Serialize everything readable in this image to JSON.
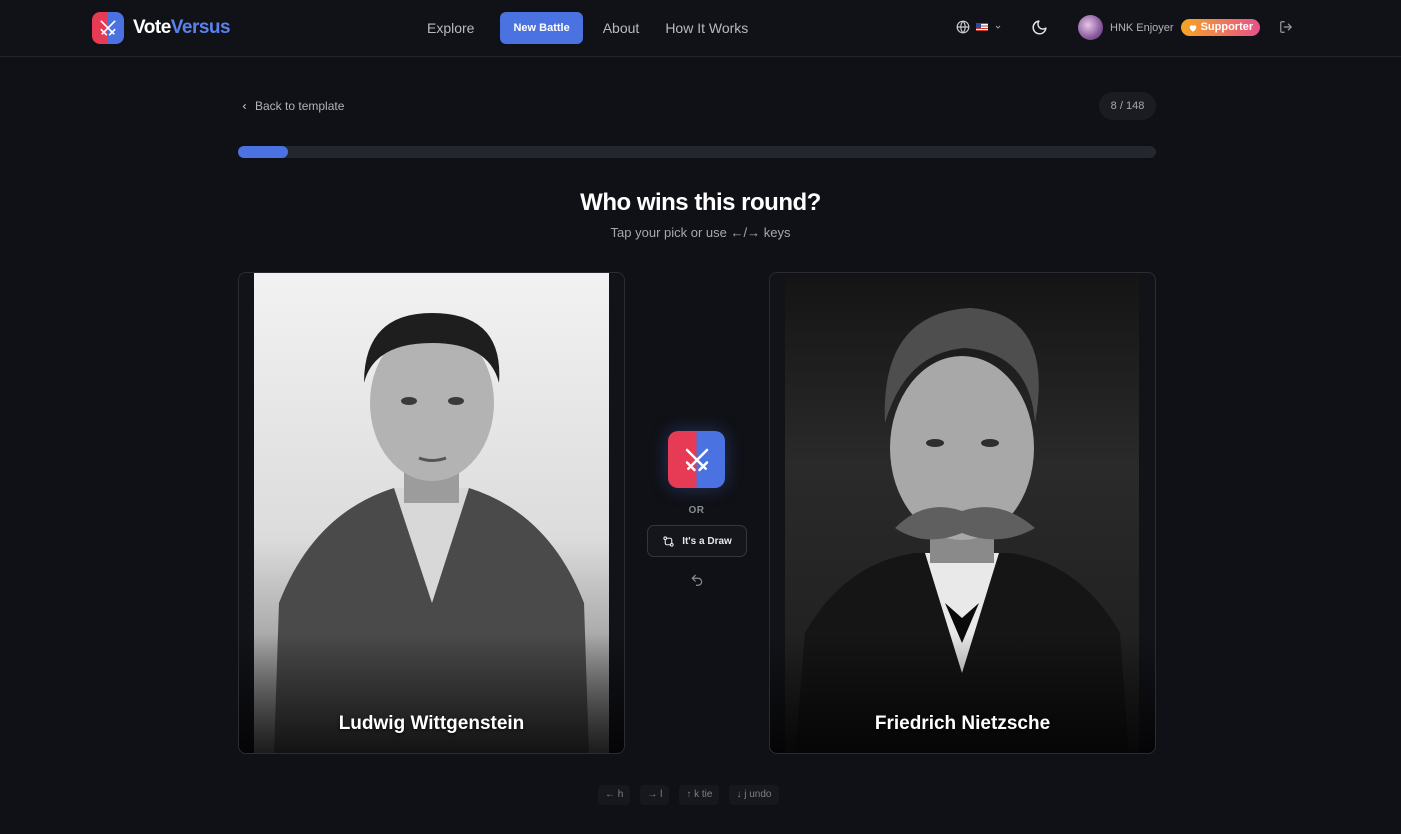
{
  "header": {
    "logo_word1": "Vote",
    "logo_word2": "Versus",
    "nav": {
      "explore": "Explore",
      "new_battle": "New Battle",
      "about": "About",
      "how_it_works": "How It Works"
    },
    "language_icon": "globe-icon",
    "theme_icon": "moon-icon",
    "user": {
      "name": "HNK Enjoyer",
      "badge": "Supporter"
    }
  },
  "back_link": "Back to template",
  "counter": "8 / 148",
  "progress": 0.054,
  "title": "Who wins this round?",
  "subtitle": "Tap your pick or use ←/→ keys",
  "contenders": {
    "left": {
      "name": "Ludwig Wittgenstein"
    },
    "right": {
      "name": "Friedrich Nietzsche"
    }
  },
  "center": {
    "or_label": "OR",
    "draw_label": "It's a Draw",
    "undo_icon": "undo-icon"
  },
  "key_hints": [
    {
      "label": "← h"
    },
    {
      "label": "→ l"
    },
    {
      "label": "↑ k tie"
    },
    {
      "label": "↓ j undo"
    }
  ],
  "colors": {
    "background": "#101116",
    "accent_blue": "#4a72e0",
    "accent_red": "#e63a55"
  }
}
